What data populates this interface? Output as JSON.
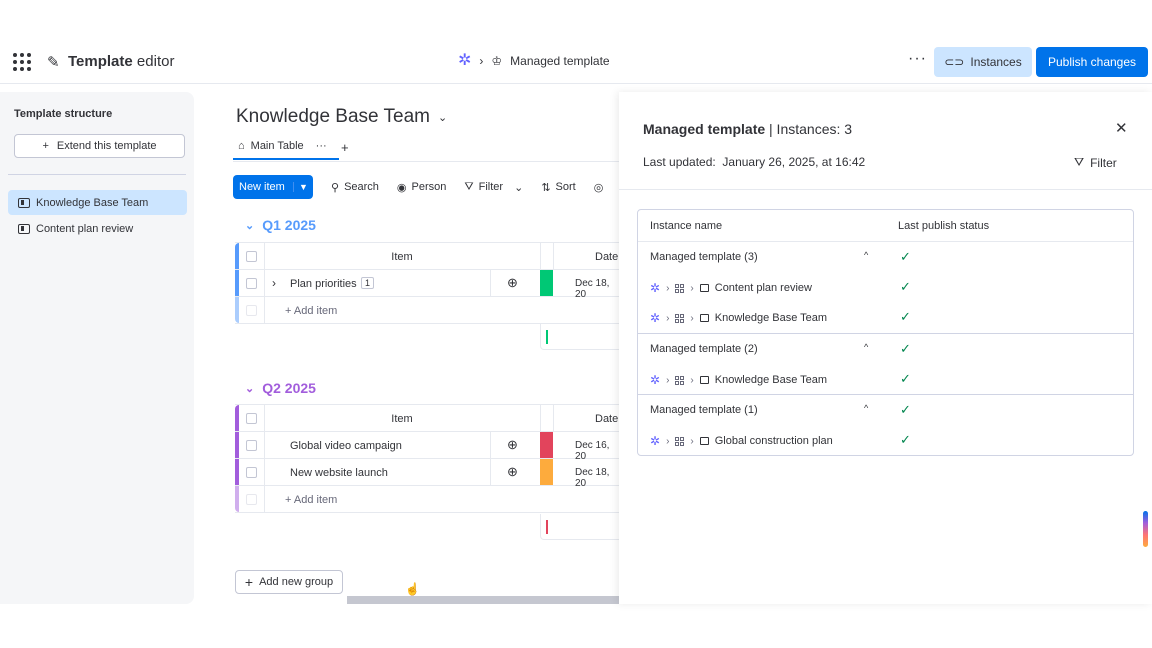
{
  "topbar": {
    "app_title_bold": "Template",
    "app_title_rest": "editor",
    "breadcrumb_label": "Managed template",
    "more_label": "···",
    "instances_label": "Instances",
    "publish_label": "Publish changes"
  },
  "left_panel": {
    "title": "Template structure",
    "extend_label": "Extend this template",
    "items": [
      {
        "label": "Knowledge Base Team",
        "active": true
      },
      {
        "label": "Content plan review",
        "active": false
      }
    ]
  },
  "board": {
    "title": "Knowledge Base Team",
    "tab_label": "Main Table",
    "toolbar": {
      "new_item": "New item",
      "search": "Search",
      "person": "Person",
      "filter": "Filter",
      "sort": "Sort"
    },
    "column_item": "Item",
    "column_date": "Date",
    "add_item": "+ Add item",
    "add_group": "Add new group",
    "groups": [
      {
        "name": "Q1 2025",
        "color": "#579bfc",
        "items": [
          {
            "name": "Plan priorities",
            "subitems": "1",
            "status_color": "#00c875",
            "date": "Dec 18, 20"
          }
        ]
      },
      {
        "name": "Q2 2025",
        "color": "#a25ddc",
        "items": [
          {
            "name": "Global video campaign",
            "status_color": "#e2445c",
            "date": "Dec 16, 20"
          },
          {
            "name": "New website launch",
            "status_color": "#fdab3d",
            "date": "Dec 18, 20"
          }
        ]
      }
    ]
  },
  "panel": {
    "title_bold": "Managed template",
    "title_rest": " | Instances: 3",
    "last_updated_label": "Last updated:",
    "last_updated_value": "January 26, 2025, at 16:42",
    "filter_label": "Filter",
    "col_instance": "Instance name",
    "col_status": "Last publish status",
    "groups": [
      {
        "name": "Managed template (3)",
        "boards": [
          "Content plan review",
          "Knowledge Base Team"
        ]
      },
      {
        "name": "Managed template (2)",
        "boards": [
          "Knowledge Base Team"
        ]
      },
      {
        "name": "Managed template (1)",
        "boards": [
          "Global construction plan"
        ]
      }
    ]
  }
}
